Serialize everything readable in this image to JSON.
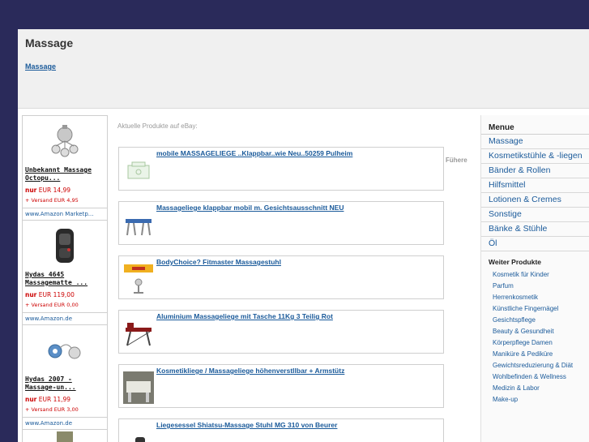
{
  "header": {
    "title": "Massage",
    "breadcrumb": "Massage"
  },
  "left_products": [
    {
      "title": "Unbekannt Massage Octopu...",
      "price_prefix": "nur",
      "price": "EUR 14,99",
      "shipping": "+ Versand EUR 4,95",
      "shop": "www.Amazon Marketp..."
    },
    {
      "title": "Hydas 4645 Massagematte ...",
      "price_prefix": "nur",
      "price": "EUR 119,00",
      "shipping": "+ Versand EUR 0,00",
      "shop": "www.Amazon.de"
    },
    {
      "title": "Hydas 2007 - Massage-un...",
      "price_prefix": "nur",
      "price": "EUR 11,99",
      "shipping": "+ Versand EUR 3,00",
      "shop": "www.Amazon.de"
    }
  ],
  "center": {
    "label": "Aktuelle Produkte auf eBay:",
    "fuehrer": "Fühere",
    "items": [
      "mobile MASSAGELIEGE ..Klappbar..wie Neu..50259 Pulheim",
      "Massageliege klappbar mobil m. Gesichtsausschnitt NEU",
      "BodyChoice? Fitmaster Massagestuhl",
      "Aluminium Massageliege mit Tasche 11Kg 3 Teilig Rot",
      "Kosmetikliege / Massageliege höhenverstllbar + Armstütz",
      "Liegesessel Shiatsu-Massage Stuhl MG 310 von Beurer"
    ]
  },
  "menu": {
    "heading": "Menue",
    "items": [
      "Massage",
      "Kosmetikstühle & -liegen",
      "Bänder & Rollen",
      "Hilfsmittel",
      "Lotionen & Cremes",
      "Sonstige",
      "Bänke & Stühle",
      "Öl"
    ],
    "weiter_heading": "Weiter Produkte",
    "weiter_items": [
      "Kosmetik für Kinder",
      "Parfum",
      "Herrenkosmetik",
      "Künstliche Fingernägel",
      "Gesichtspflege",
      "Beauty & Gesundheit",
      "Körperpflege Damen",
      "Maniküre & Pediküre",
      "Gewichtsreduzierung & Diät",
      "Wohlbefinden & Wellness",
      "Medizin & Labor",
      "Make-up"
    ]
  },
  "colors": {
    "background": "#2a2a5a",
    "link": "#1a5a9a",
    "price": "#cc0000"
  }
}
